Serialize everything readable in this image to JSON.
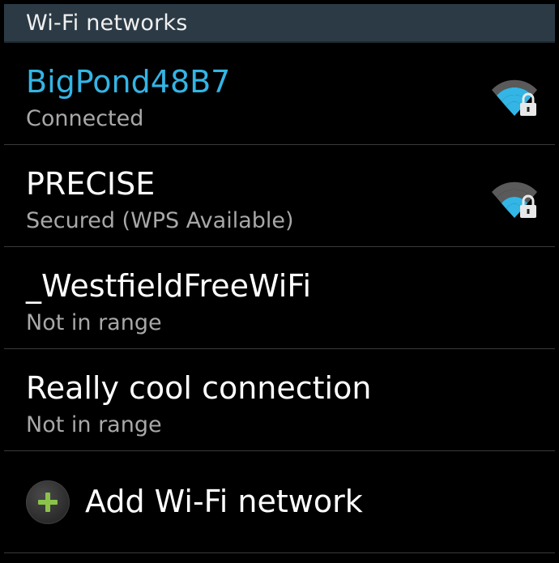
{
  "header": {
    "title": "Wi-Fi networks"
  },
  "networks": [
    {
      "name": "BigPond48B7",
      "status": "Connected",
      "connected": true,
      "secured": true,
      "icon": "wifi-signal-lock-icon"
    },
    {
      "name": "PRECISE",
      "status": "Secured (WPS Available)",
      "connected": false,
      "secured": true,
      "icon": "wifi-signal-lock-icon"
    },
    {
      "name": "_WestfieldFreeWiFi",
      "status": "Not in range",
      "connected": false,
      "secured": false
    },
    {
      "name": "Really cool connection",
      "status": "Not in range",
      "connected": false,
      "secured": false
    }
  ],
  "add_network": {
    "label": "Add Wi-Fi network",
    "icon": "plus-icon"
  },
  "colors": {
    "accent": "#33b5e5",
    "header_bg": "#2b3a45",
    "add_plus": "#8bc34a"
  }
}
